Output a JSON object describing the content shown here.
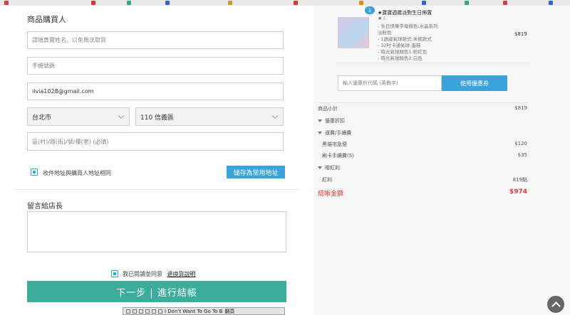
{
  "form": {
    "section_title": "商品購買人",
    "name_placeholder": "請填真實姓名，以免無法取貨",
    "phone_placeholder": "手機號碼",
    "email_value": "ilvia1028@gmail.com",
    "city_value": "台北市",
    "district_value": "110 信義區",
    "address_placeholder": "區(村)/路(街)/號/樓(室) (必填)",
    "same_address_label": "收件地址與購買人地址相同",
    "save_address_button": "儲存為常用地址",
    "message_title": "留言給店長",
    "agree_text": "我已閱讀並同意",
    "return_policy_link": "退換貨說明",
    "next_button": "下一步 | 進行結帳"
  },
  "player": {
    "track_title": "I Don't Want To Go To B",
    "more_label": "翻頁"
  },
  "order": {
    "badge_count": "1",
    "product_title": "★寶寶週歲派對生日佈置",
    "product_sub": "★☆",
    "options": [
      "- 生日快樂字母顏色:水晶系列",
      "  淡粉色",
      "- 1週歲氣球款式:米妮款式",
      "- 32吋卡通氣球:蛋糕",
      "- 時光氣球顏色1:粉紅色",
      "- 時光氣球顏色2:白色"
    ],
    "product_price": "$819",
    "coupon_placeholder": "輸入優惠折代碼 (英數字)",
    "coupon_button": "使用優惠券",
    "subtotal_label": "商品小計",
    "subtotal_value": "$819",
    "discount_label": "優惠折扣",
    "shipping_label": "運費/手續費",
    "delivery_label": "黑貓宅急便",
    "delivery_value": "$120",
    "card_fee_label": "刷卡手續費(5)",
    "card_fee_value": "$35",
    "bonus_label": "贈紅利",
    "bonus_item_label": "紅利",
    "bonus_item_value": "819點",
    "total_label": "結帳金額",
    "total_value": "$974"
  },
  "colors": {
    "accent_blue": "#3aa3d9",
    "next_green": "#3eac9b",
    "total_red": "#e03b3b"
  }
}
